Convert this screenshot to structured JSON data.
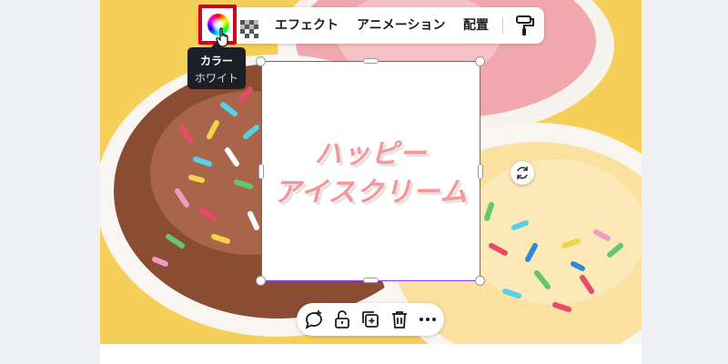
{
  "toolbar": {
    "color_button": {
      "icon": "color-wheel-icon",
      "highlight": "#d0021b"
    },
    "transparency_icon": "transparency-icon",
    "effects_label": "エフェクト",
    "animation_label": "アニメーション",
    "position_label": "配置",
    "copy_style_icon": "paint-roller-icon"
  },
  "tooltip": {
    "title": "カラー",
    "value": "ホワイト"
  },
  "textbox": {
    "line1": "ハッピー",
    "line2": "アイスクリーム",
    "text_color": "#f29898",
    "background": "#ffffff",
    "selection_color": "#8b3dff"
  },
  "context_menu": {
    "icons": [
      "comment-add-icon",
      "unlock-icon",
      "duplicate-icon",
      "trash-icon",
      "more-icon"
    ]
  },
  "colors": {
    "canvas_background": "#f4cf57",
    "workspace": "#eef0f4"
  }
}
